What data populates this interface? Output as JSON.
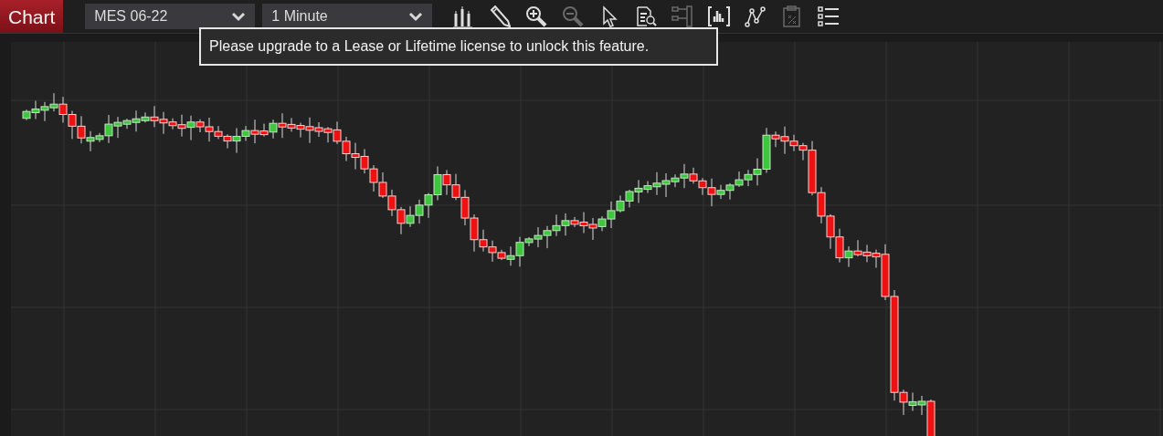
{
  "title": "Chart",
  "selectors": [
    {
      "value": "MES 06-22"
    },
    {
      "value": "1 Minute"
    }
  ],
  "toolbar": [
    {
      "kind": "candles",
      "disabled": false
    },
    {
      "kind": "pencil",
      "disabled": false
    },
    {
      "kind": "zoom-in",
      "disabled": false
    },
    {
      "kind": "zoom-out",
      "disabled": true
    },
    {
      "kind": "cursor",
      "disabled": false
    },
    {
      "kind": "doc-search",
      "disabled": false
    },
    {
      "kind": "hierarchy",
      "disabled": true
    },
    {
      "kind": "bars",
      "disabled": false
    },
    {
      "kind": "line",
      "disabled": false
    },
    {
      "kind": "clipboard",
      "disabled": true
    },
    {
      "kind": "list",
      "disabled": false
    }
  ],
  "tooltip": "Please upgrade to a Lease or Lifetime license to unlock this feature."
}
